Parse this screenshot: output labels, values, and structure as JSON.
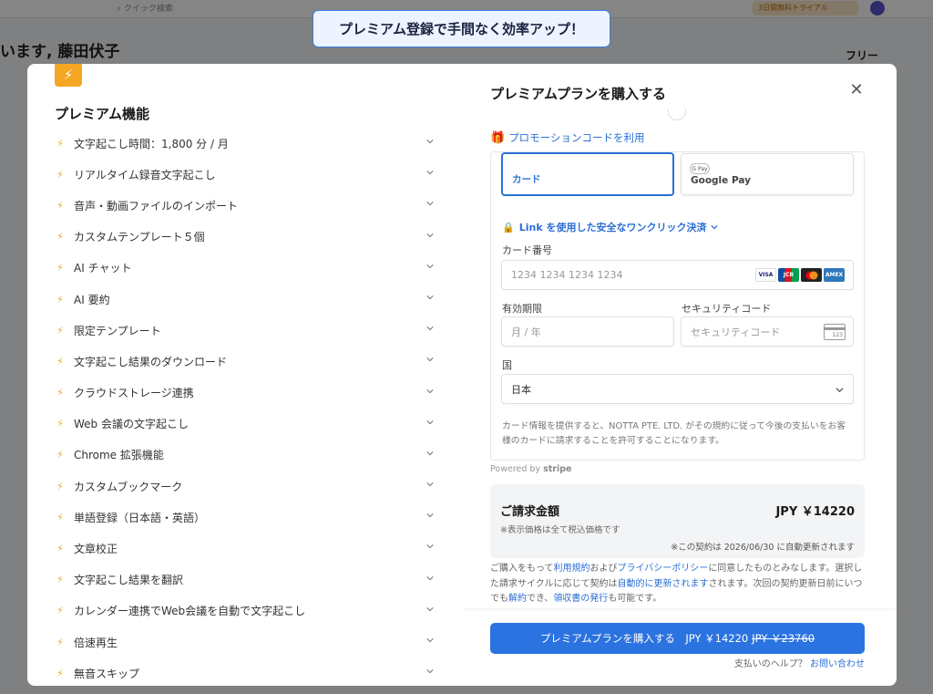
{
  "background": {
    "search_placeholder": "クイック検索",
    "trial_badge": "3日間無料トライアル",
    "greeting": "います, 藤田伏子",
    "plan_label": "フリー"
  },
  "banner": {
    "text": "プレミアム登録で手間なく効率アップ！"
  },
  "features": {
    "title": "プレミアム機能",
    "items": [
      "文字起こし時間：1,800 分 / 月",
      "リアルタイム録音文字起こし",
      "音声・動画ファイルのインポート",
      "カスタムテンプレート５個",
      "AI チャット",
      "AI 要約",
      "限定テンプレート",
      "文字起こし結果のダウンロード",
      "クラウドストレージ連携",
      "Web 会議の文字起こし",
      "Chrome 拡張機能",
      "カスタムブックマーク",
      "単語登録（日本語・英語）",
      "文章校正",
      "文字起こし結果を翻訳",
      "カレンダー連携でWeb会議を自動で文字起こし",
      "倍速再生",
      "無音スキップ"
    ]
  },
  "purchase": {
    "title": "プレミアムプランを購入する",
    "promo_link": "プロモーションコードを利用",
    "tabs": {
      "card": "カード",
      "gpay": "Google Pay",
      "gpay_logo": "G Pay"
    },
    "link_checkout": "Link を使用した安全なワンクリック決済",
    "card_number_label": "カード番号",
    "card_number_placeholder": "1234 1234 1234 1234",
    "brands": [
      "VISA",
      "JCB",
      "MC",
      "AMEX"
    ],
    "expiry_label": "有効期限",
    "expiry_placeholder": "月 / 年",
    "cvc_label": "セキュリティコード",
    "cvc_placeholder": "セキュリティコード",
    "cvc_icon_number": "123",
    "country_label": "国",
    "country_value": "日本",
    "consent": "カード情報を提供すると、NOTTA PTE. LTD. がその規約に従って今後の支払いをお客様のカードに請求することを許可することになります。",
    "powered_by": "Powered by",
    "powered_brand": "stripe",
    "billing": {
      "label": "ご請求金額",
      "amount": "JPY ￥14220",
      "tax_note": "※表示価格は全て税込価格です",
      "renew_note": "※この契約は 2026/06/30 に自動更新されます"
    },
    "terms": {
      "t1": "ご購入をもって",
      "link_terms": "利用規約",
      "t2": "および",
      "link_privacy": "プライバシーポリシー",
      "t3": "に同意したものとみなします。選択した請求サイクルに応じて契約は",
      "link_autorenew": "自動的に更新されます",
      "t4": "されます。次回の契約更新日前にいつでも",
      "link_cancel": "解約",
      "t5": "でき、",
      "link_receipt": "領収書の発行",
      "t6": "も可能です。"
    },
    "buy_button": "プレミアムプランを購入する　JPY ￥14220",
    "buy_button_original": "JPY ￥23760",
    "help_text": "支払いのヘルプ？",
    "help_link": "お問い合わせ"
  }
}
